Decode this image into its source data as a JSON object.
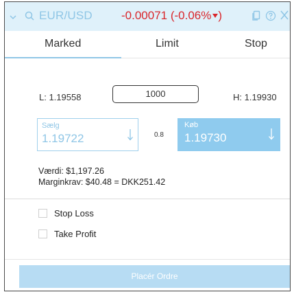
{
  "header": {
    "pair": "EUR/USD",
    "change": "-0.00071 (-0.06%",
    "icons": [
      "chevron-down-icon",
      "search-icon",
      "copy-icon",
      "help-icon",
      "close-icon"
    ]
  },
  "tabs": [
    {
      "label": "Marked",
      "active": true
    },
    {
      "label": "Limit",
      "active": false
    },
    {
      "label": "Stop",
      "active": false
    }
  ],
  "order": {
    "low": "L: 1.19558",
    "amount": "1000",
    "high": "H: 1.19930"
  },
  "sell": {
    "label": "Sælg",
    "price": "1.19722"
  },
  "spread": "0.8",
  "buy": {
    "label": "Køb",
    "price": "1.19730"
  },
  "info": {
    "value": "Værdi: $1,197.26",
    "margin": "Marginkrav: $40.48 = DKK251.42"
  },
  "options": {
    "stop_loss": "Stop Loss",
    "take_profit": "Take Profit"
  },
  "submit_label": "Placér Ordre",
  "colors": {
    "accent": "#8fc6e6",
    "header_bg": "#dff1fa",
    "negative": "#d9262b",
    "buy_bg": "#8fcbee",
    "submit_bg": "#b7dcf3"
  }
}
